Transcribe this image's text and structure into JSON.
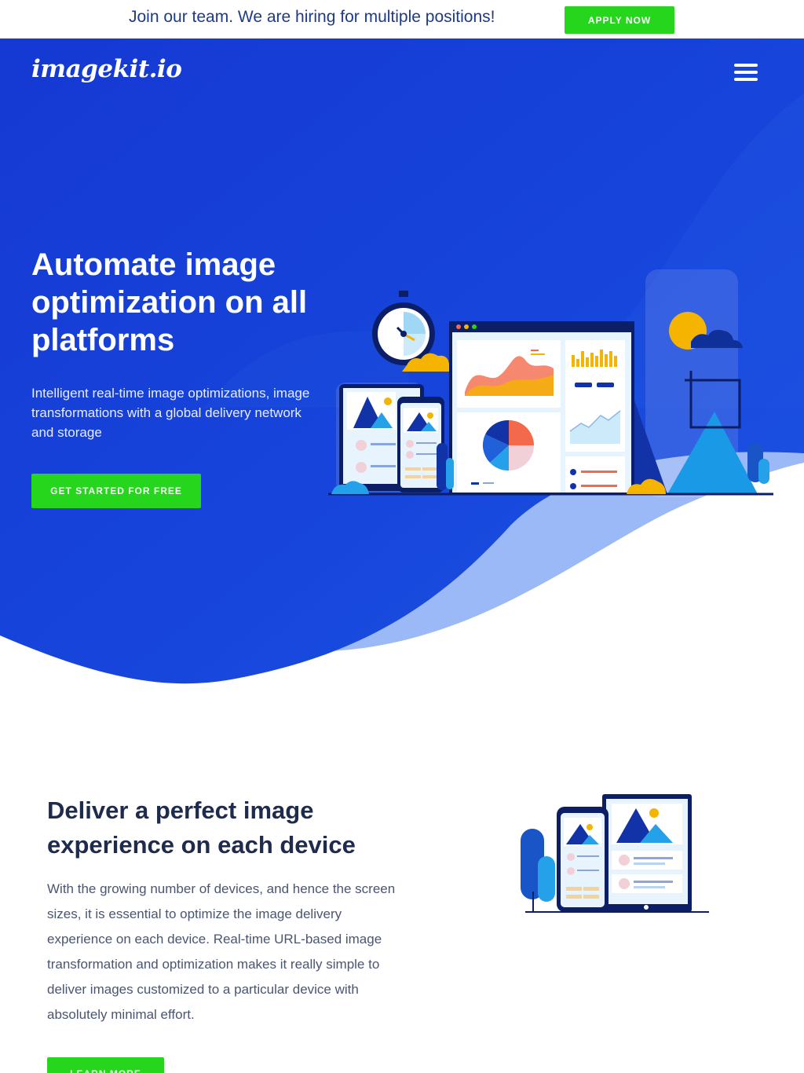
{
  "topbar": {
    "message": "Join our team. We are hiring for multiple positions!",
    "apply_label": "APPLY NOW"
  },
  "header": {
    "logo": "imagekit.io",
    "menu_icon": "hamburger-menu-icon"
  },
  "hero": {
    "title": "Automate image optimization on all platforms",
    "subtitle": "Intelligent real-time image optimizations, image transformations with a global delivery network and storage",
    "cta_label": "GET STARTED FOR FREE"
  },
  "section_devices": {
    "title": "Deliver a perfect image experience on each device",
    "body": "With the growing number of devices, and hence the screen sizes, it is essential to optimize the image delivery experience on each device. Real-time URL-based image transformation and optimization makes it really simple to deliver images customized to a particular device with absolutely minimal effort.",
    "learn_label": "LEARN MORE"
  },
  "colors": {
    "brand_blue": "#1447d6",
    "accent_green": "#26d61c",
    "wave_light": "#9bb8f7"
  }
}
